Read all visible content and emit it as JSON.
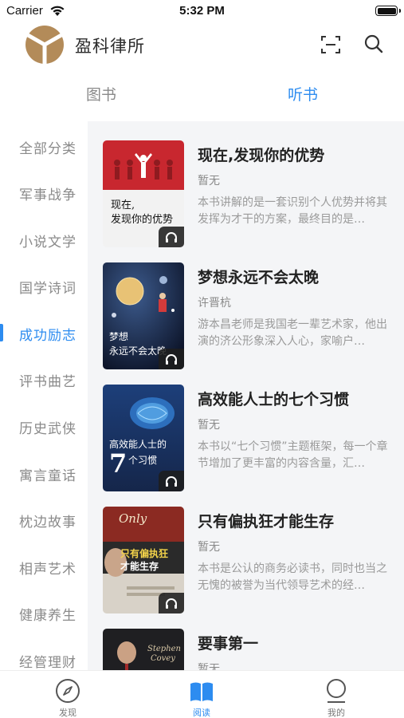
{
  "status_bar": {
    "carrier": "Carrier",
    "time": "5:32 PM"
  },
  "header": {
    "title": "盈科律所"
  },
  "tabs": [
    {
      "label": "图书",
      "active": false
    },
    {
      "label": "听书",
      "active": true
    }
  ],
  "categories": [
    {
      "label": "全部分类"
    },
    {
      "label": "军事战争"
    },
    {
      "label": "小说文学"
    },
    {
      "label": "国学诗词"
    },
    {
      "label": "成功励志",
      "active": true
    },
    {
      "label": "评书曲艺"
    },
    {
      "label": "历史武侠"
    },
    {
      "label": "寓言童话"
    },
    {
      "label": "枕边故事"
    },
    {
      "label": "相声艺术"
    },
    {
      "label": "健康养生"
    },
    {
      "label": "经管理财"
    }
  ],
  "books": [
    {
      "title": "现在,发现你的优势",
      "author": "暂无",
      "description": "本书讲解的是一套识别个人优势并将其发挥为才干的方案，最终目的是…",
      "cover_text": [
        "现在,",
        "发现你的优势"
      ]
    },
    {
      "title": "梦想永远不会太晚",
      "author": "许晋杭",
      "description": "游本昌老师是我国老一辈艺术家，他出演的济公形象深入人心，家喻户…",
      "cover_text": [
        "梦想",
        "永远不会太晚"
      ]
    },
    {
      "title": "高效能人士的七个习惯",
      "author": "暂无",
      "description": "本书以“七个习惯”主题框架，每一个章节增加了更丰富的内容含量，汇…",
      "cover_text": [
        "高效能人士的",
        "7",
        "个习惯"
      ]
    },
    {
      "title": "只有偏执狂才能生存",
      "author": "暂无",
      "description": "本书是公认的商务必读书，同时也当之无愧的被誉为当代领导艺术的经…",
      "cover_text": [
        "Only",
        "只有偏执狂",
        "才能生存"
      ]
    },
    {
      "title": "要事第一",
      "author": "暂无",
      "description": "",
      "cover_text": [
        "Stephen",
        "Covey"
      ]
    }
  ],
  "bottom_nav": [
    {
      "label": "发现",
      "icon": "compass-icon"
    },
    {
      "label": "阅读",
      "icon": "book-icon",
      "active": true
    },
    {
      "label": "我的",
      "icon": "user-icon"
    }
  ],
  "colors": {
    "accent": "#2d8cf0",
    "logo": "#b38b59",
    "list_bg": "#f4f5f7"
  }
}
